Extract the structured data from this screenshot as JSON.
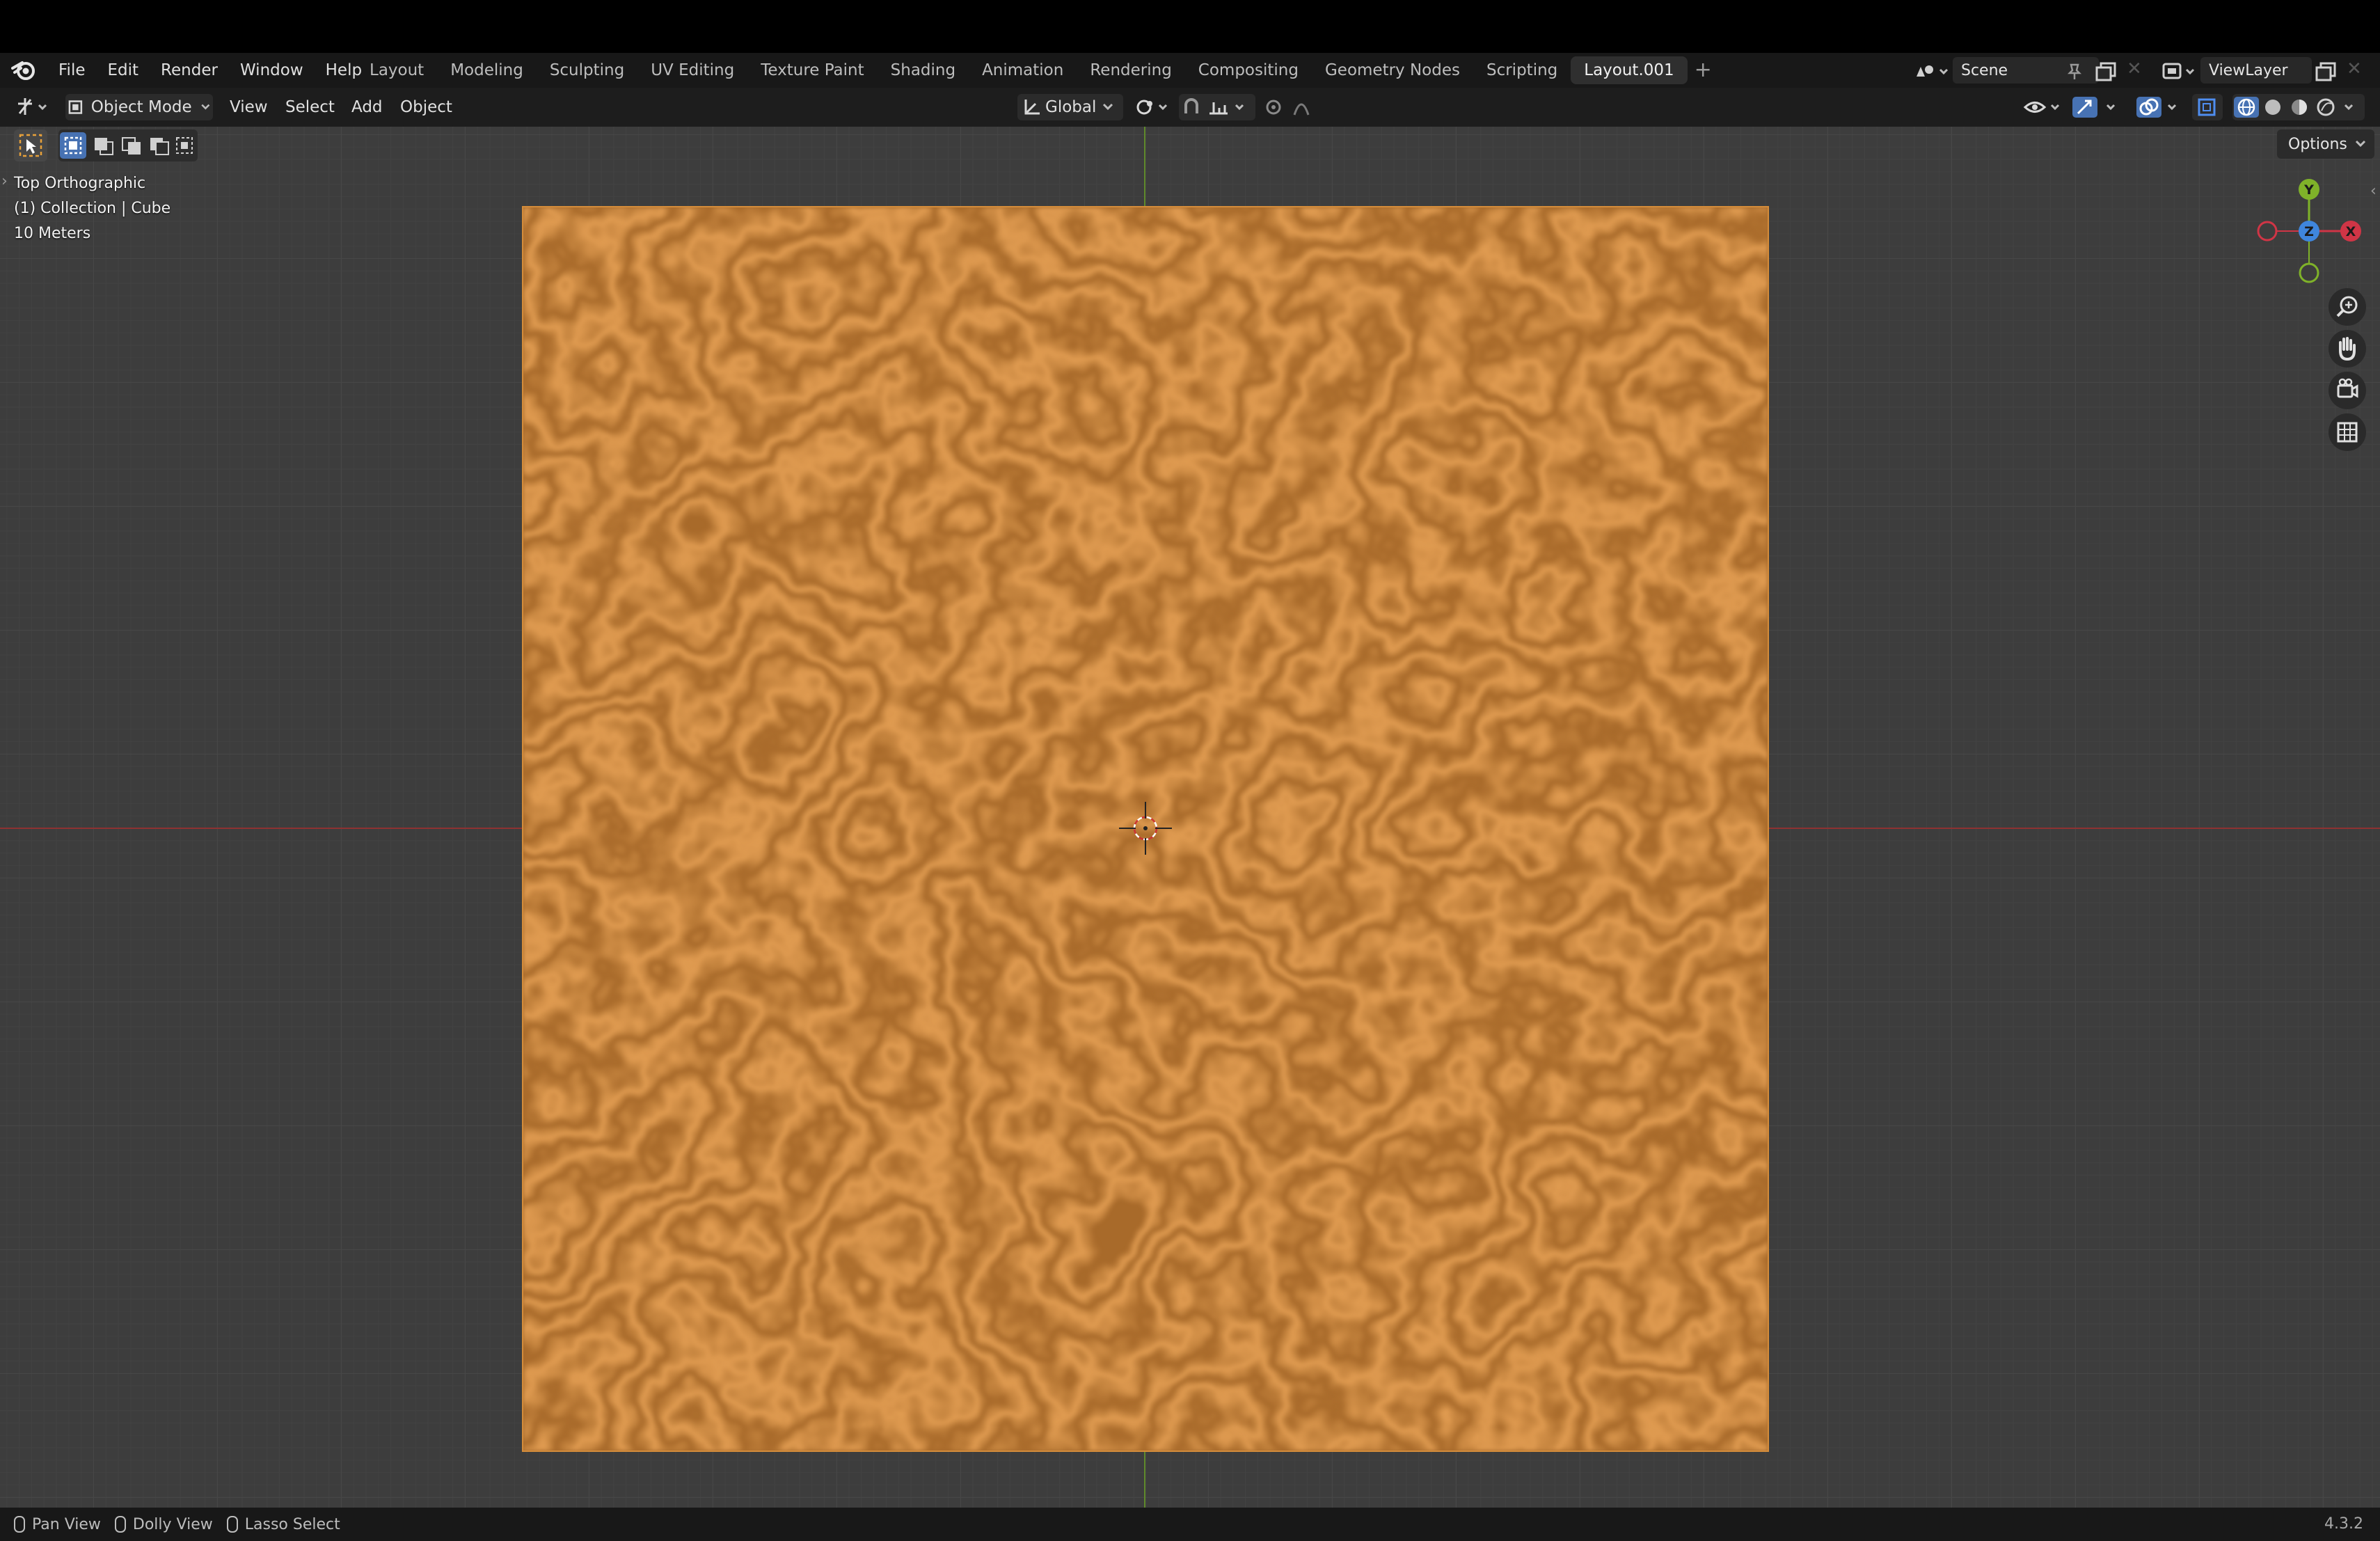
{
  "colors": {
    "accent_blue": "#4772b3",
    "plane_base": "#a86a2a",
    "plane_vein": "#e7a256",
    "x_axis": "#d03546",
    "y_axis": "#7fb229",
    "z_axis": "#3f86dd"
  },
  "menus": [
    "File",
    "Edit",
    "Render",
    "Window",
    "Help"
  ],
  "workspaces": [
    "Layout",
    "Modeling",
    "Sculpting",
    "UV Editing",
    "Texture Paint",
    "Shading",
    "Animation",
    "Rendering",
    "Compositing",
    "Geometry Nodes",
    "Scripting",
    "Layout.001"
  ],
  "active_workspace": "Layout.001",
  "scene": {
    "name": "Scene"
  },
  "view_layer": {
    "name": "ViewLayer"
  },
  "header": {
    "mode": "Object Mode",
    "menus": [
      "View",
      "Select",
      "Add",
      "Object"
    ],
    "orientation": "Global"
  },
  "options_label": "Options",
  "overlay": {
    "view_name": "Top Orthographic",
    "collection": "(1) Collection | Cube",
    "scale": "10 Meters"
  },
  "gizmo": {
    "x": "X",
    "y": "Y",
    "z": "Z"
  },
  "status": {
    "items": [
      "Pan View",
      "Dolly View",
      "Lasso Select"
    ],
    "version": "4.3.2"
  }
}
